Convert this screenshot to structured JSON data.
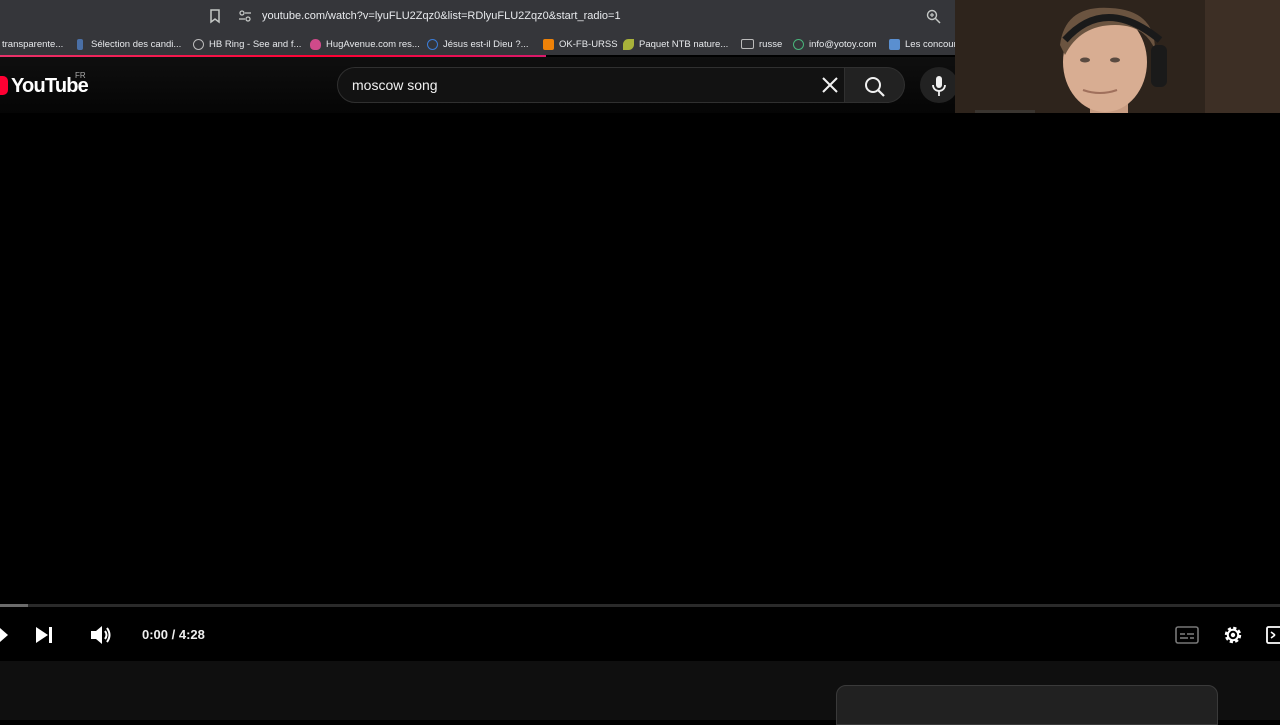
{
  "browser": {
    "url": "youtube.com/watch?v=lyuFLU2Zqz0&list=RDlyuFLU2Zqz0&start_radio=1",
    "bookmarks": [
      {
        "label": "transparente...",
        "icon": "none",
        "color": "#35363a"
      },
      {
        "label": "Sélection des candi...",
        "icon": "page-icon",
        "color": "#4a6fa5"
      },
      {
        "label": "HB Ring - See and f...",
        "icon": "globe-icon",
        "color": "#9aa0a6"
      },
      {
        "label": "HugAvenue.com res...",
        "icon": "heart-icon",
        "color": "#d04a8a"
      },
      {
        "label": "Jésus est-il Dieu ?...",
        "icon": "info-icon",
        "color": "#3b7dd8"
      },
      {
        "label": "OK-FB-URSS",
        "icon": "ok-icon",
        "color": "#ee8208"
      },
      {
        "label": "Paquet NTB nature...",
        "icon": "leaf-icon",
        "color": "#a8b23a"
      },
      {
        "label": "russe",
        "icon": "folder-icon",
        "color": "#9aa0a6"
      },
      {
        "label": "info@yotoy.com",
        "icon": "mail-icon",
        "color": "#49b37a"
      },
      {
        "label": "Les concours",
        "icon": "image-icon",
        "color": "#5a8fd0"
      }
    ]
  },
  "masthead": {
    "logo_text": "YouTube",
    "country_code": "FR",
    "search_query": "moscow song"
  },
  "player": {
    "time_current": "0:00",
    "time_separator": " / ",
    "time_total": "4:28",
    "progress_loaded_fraction": 0.022,
    "play_progress_fraction": 0.0
  },
  "colors": {
    "accent_red": "#ff0033",
    "background": "#000000"
  }
}
